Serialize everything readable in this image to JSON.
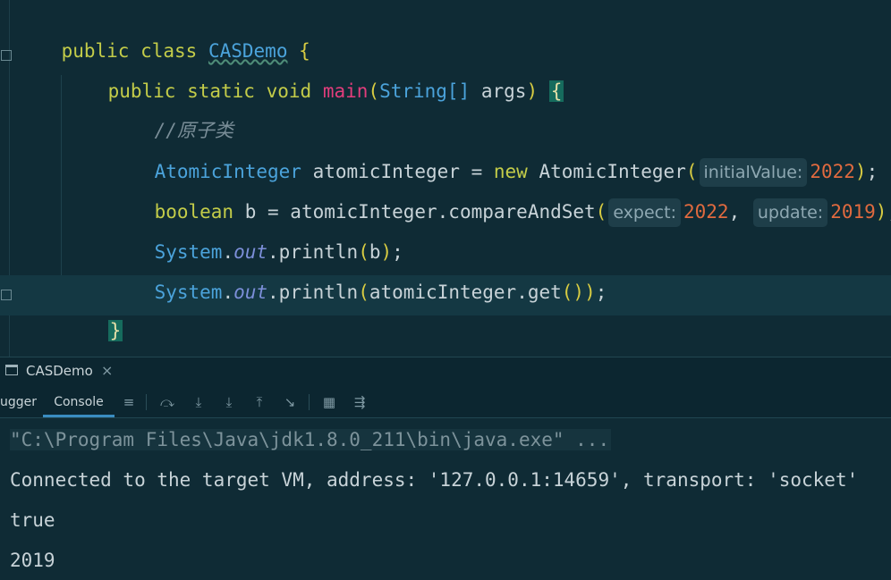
{
  "editor": {
    "lines": {
      "l1": {
        "kw1": "public",
        "kw2": "class",
        "cls": "CASDemo",
        "brace": "{"
      },
      "l2": {
        "kw1": "public",
        "kw2": "static",
        "kw3": "void",
        "fn": "main",
        "p1": "(",
        "type": "String[]",
        "arg": " args",
        "p2": ")",
        "brace": "{"
      },
      "l3": {
        "comment": "//原子类"
      },
      "l4": {
        "type": "AtomicInteger",
        "var": " atomicInteger = ",
        "kw": "new",
        "ctor": " AtomicInteger",
        "p1": "(",
        "hint": "initialValue:",
        "num": "2022",
        "p2": ")",
        "end": ";"
      },
      "l5": {
        "type": "boolean",
        "rest": " b = atomicInteger.compareAndSet",
        "p1": "(",
        "hint1": "expect:",
        "num1": "2022",
        "comma": ", ",
        "hint2": "update:",
        "num2": "2019",
        "p2": ")",
        "end": ";"
      },
      "l6": {
        "cls": "System",
        "dot": ".",
        "field": "out",
        "call": ".println",
        "p1": "(",
        "arg": "b",
        "p2": ")",
        "end": ";"
      },
      "l7": {
        "cls": "System",
        "dot": ".",
        "field": "out",
        "call": ".println",
        "p1": "(",
        "arg": "atomicInteger.get",
        "p2": "())",
        "end": ";"
      },
      "l8": {
        "brace": "}"
      },
      "l9": {
        "brace": "}"
      }
    }
  },
  "tool_window": {
    "title": "CASDemo",
    "close_glyph": "×",
    "tabs": [
      "ugger",
      "Console"
    ]
  },
  "console": {
    "lines": [
      "\"C:\\Program Files\\Java\\jdk1.8.0_211\\bin\\java.exe\" ...",
      "Connected to the target VM, address: '127.0.0.1:14659', transport: 'socket'",
      "true",
      "2019"
    ]
  },
  "icons": [
    "window-icon",
    "close-icon",
    "menu-icon",
    "step-over-icon",
    "step-into-icon",
    "force-step-into-icon",
    "step-out-icon",
    "run-to-cursor-icon",
    "evaluate-icon",
    "trace-icon"
  ],
  "colors": {
    "background": "#0f2b35",
    "keyword": "#c3cc49",
    "class": "#4ba3db",
    "method": "#e23d7c",
    "number": "#e06a3f",
    "accent": "#3a8cc1"
  }
}
